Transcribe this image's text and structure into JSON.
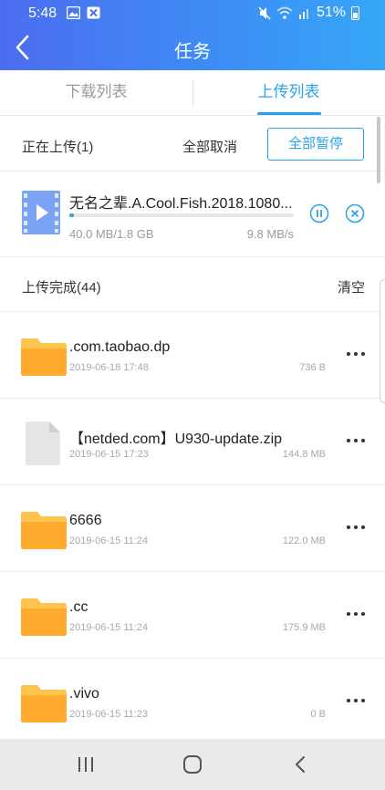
{
  "status_bar": {
    "time": "5:48",
    "battery_text": "51%",
    "icons": [
      "gallery-icon",
      "app-notification-icon",
      "mute-icon",
      "wifi-icon",
      "signal-icon",
      "battery-icon"
    ]
  },
  "header": {
    "title": "任务",
    "back_icon": "back-arrow-icon",
    "colors": {
      "gradient_start": "#4d6cf0",
      "gradient_end": "#36a7f6"
    }
  },
  "tabs": [
    {
      "label": "下载列表",
      "active": false
    },
    {
      "label": "上传列表",
      "active": true
    }
  ],
  "accent_color": "#29a3e8",
  "uploading": {
    "heading": "正在上传(1)",
    "cancel_all": "全部取消",
    "pause_all": "全部暂停",
    "item": {
      "name": "无名之辈.A.Cool.Fish.2018.1080...",
      "size_progress": "40.0 MB/1.8 GB",
      "speed": "9.8 MB/s",
      "progress": 0.022,
      "icon": "video-file-icon"
    }
  },
  "completed": {
    "heading": "上传完成(44)",
    "clear_label": "清空",
    "items": [
      {
        "name": ".com.taobao.dp",
        "date": "2019-06-18 17:48",
        "size": "736 B",
        "icon": "folder-icon"
      },
      {
        "name": "【netded.com】U930-update.zip",
        "date": "2019-06-15 17:23",
        "size": "144.8 MB",
        "icon": "file-icon"
      },
      {
        "name": "6666",
        "date": "2019-06-15 11:24",
        "size": "122.0 MB",
        "icon": "folder-icon"
      },
      {
        "name": ".cc",
        "date": "2019-06-15 11:24",
        "size": "175.9 MB",
        "icon": "folder-icon"
      },
      {
        "name": ".vivo",
        "date": "2019-06-15 11:23",
        "size": "0 B",
        "icon": "folder-icon"
      }
    ]
  },
  "nav_bar": {
    "buttons": [
      "recent-apps-icon",
      "home-icon",
      "back-icon"
    ]
  }
}
